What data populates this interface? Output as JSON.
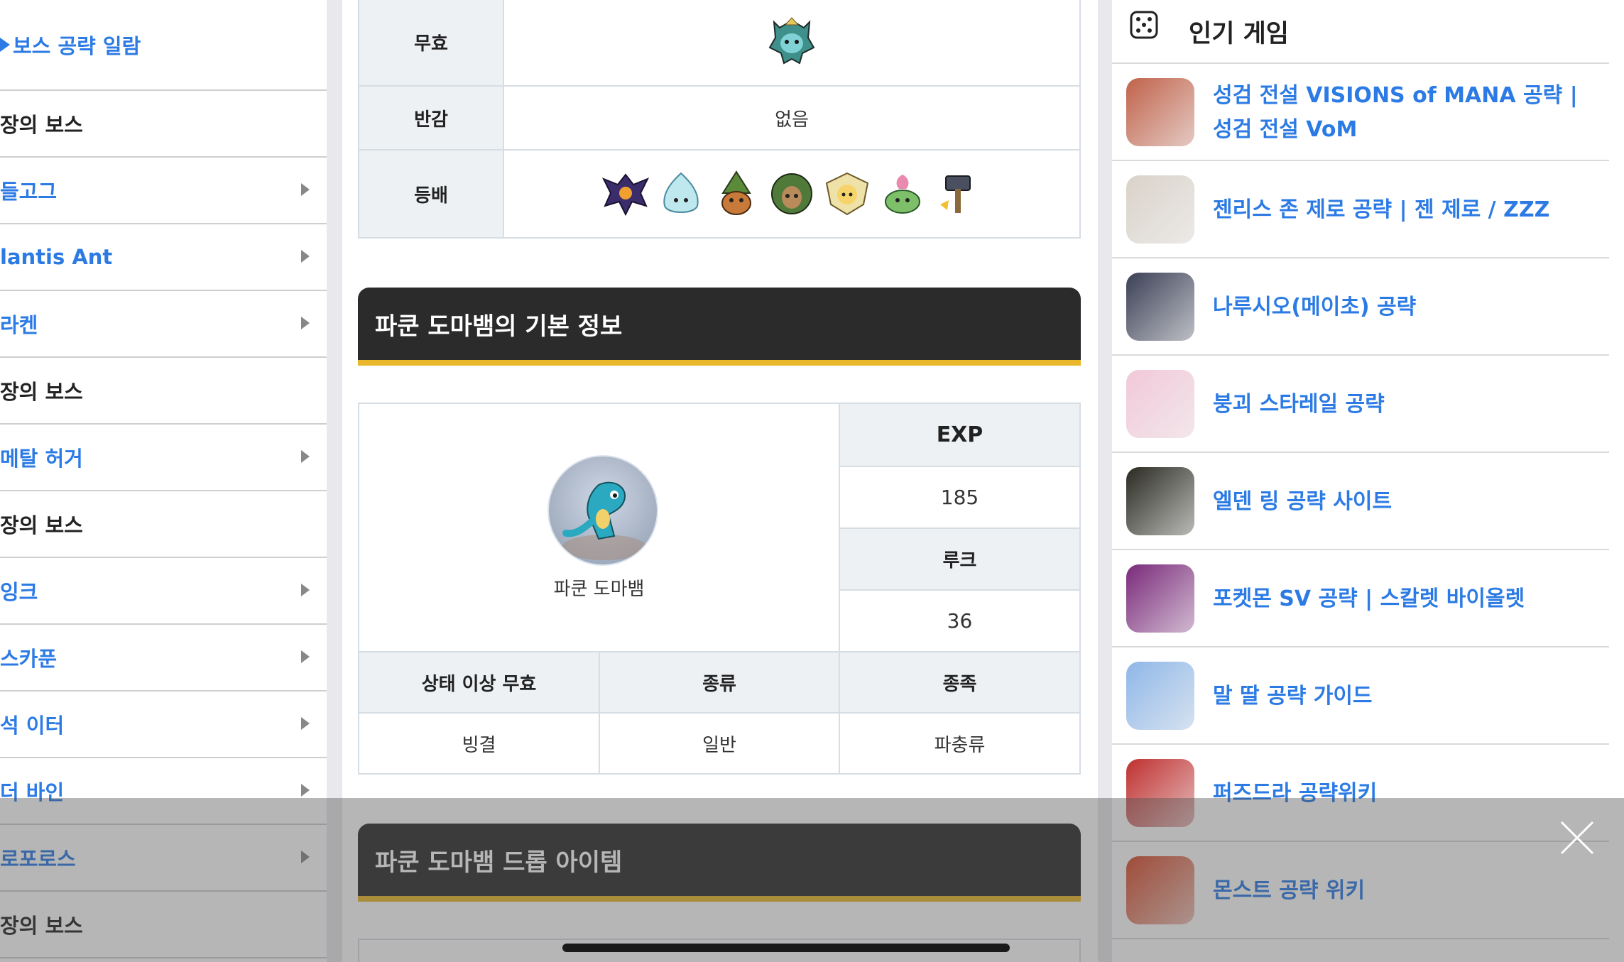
{
  "sidebar": {
    "title": "보스 공략 일람",
    "items": [
      {
        "label": "장의 보스",
        "type": "head"
      },
      {
        "label": "들고그",
        "type": "link"
      },
      {
        "label": "lantis Ant",
        "type": "link"
      },
      {
        "label": "라켄",
        "type": "link"
      },
      {
        "label": "장의 보스",
        "type": "head"
      },
      {
        "label": " 메탈 허거",
        "type": "link"
      },
      {
        "label": "장의 보스",
        "type": "head"
      },
      {
        "label": "잉크",
        "type": "link"
      },
      {
        "label": "스카푼",
        "type": "link"
      },
      {
        "label": "석 이터",
        "type": "link"
      },
      {
        "label": "더 바인",
        "type": "link"
      },
      {
        "label": "로포로스",
        "type": "link"
      },
      {
        "label": "장의 보스",
        "type": "head"
      }
    ]
  },
  "resist_table": {
    "rows": [
      {
        "label": "무효",
        "value": "",
        "icons": [
          "masked-monster-icon"
        ]
      },
      {
        "label": "반감",
        "value": "없음",
        "icons": []
      },
      {
        "label": "등배",
        "value": "",
        "icons": [
          "dragon-icon",
          "ice-slime-icon",
          "gnome-icon",
          "tree-spirit-icon",
          "fairy-icon",
          "leaf-slime-icon",
          "hammer-icon"
        ]
      }
    ]
  },
  "basic_info": {
    "heading": "파쿤 도마뱀의 기본 정보",
    "monster_name": "파쿤 도마뱀",
    "exp_label": "EXP",
    "exp_value": "185",
    "look_label": "루크",
    "look_value": "36",
    "status_label": "상태 이상 무효",
    "status_value": "빙결",
    "kind_label": "종류",
    "kind_value": "일반",
    "family_label": "종족",
    "family_value": "파충류"
  },
  "drop_items": {
    "heading": "파쿤 도마뱀 드롭 아이템"
  },
  "popular": {
    "title": "인기 게임",
    "games": [
      {
        "label": "성검 전설 VISIONS of MANA 공략 | 성검 전설 VoM",
        "thumb_color": "#c0624a"
      },
      {
        "label": "젠리스 존 제로 공략 | 젠 제로 / ZZZ",
        "thumb_color": "#d9d2c9"
      },
      {
        "label": "나루시오(메이초) 공략",
        "thumb_color": "#3a3f55"
      },
      {
        "label": "붕괴 스타레일 공략",
        "thumb_color": "#f2c8d8"
      },
      {
        "label": "엘덴 링 공략 사이트",
        "thumb_color": "#2a2a22"
      },
      {
        "label": "포켓몬 SV 공략 | 스칼렛 바이올렛",
        "thumb_color": "#7a2a7a"
      },
      {
        "label": "말 딸 공략 가이드",
        "thumb_color": "#8fb7e8"
      },
      {
        "label": "퍼즈드라 공략위키",
        "thumb_color": "#c03030"
      },
      {
        "label": "몬스트 공략 위키",
        "thumb_color": "#d94a2a"
      }
    ]
  },
  "colors": {
    "accent_blue": "#2c7be5",
    "header_dark": "#2b2b2b",
    "header_underline": "#e8b82a"
  }
}
